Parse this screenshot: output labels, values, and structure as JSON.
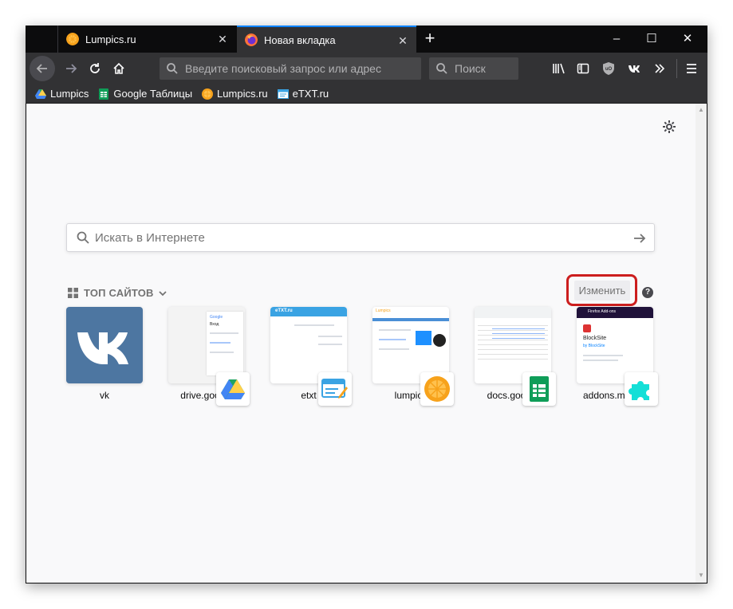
{
  "tabs": [
    {
      "title": "Lumpics.ru",
      "active": false
    },
    {
      "title": "Новая вкладка",
      "active": true
    }
  ],
  "toolbar": {
    "url_placeholder": "Введите поисковый запрос или адрес",
    "search_placeholder": "Поиск"
  },
  "bookmarks": [
    {
      "label": "Lumpics",
      "icon": "google-drive-icon"
    },
    {
      "label": "Google Таблицы",
      "icon": "google-sheets-icon"
    },
    {
      "label": "Lumpics.ru",
      "icon": "lumpics-orange-icon"
    },
    {
      "label": "eTXT.ru",
      "icon": "etxt-icon"
    }
  ],
  "newtab": {
    "search_placeholder": "Искать в Интернете",
    "topsites_title": "ТОП САЙТОВ",
    "edit_label": "Изменить",
    "help_label": "?"
  },
  "topsites": [
    {
      "label": "vk"
    },
    {
      "label": "drive.google"
    },
    {
      "label": "etxt"
    },
    {
      "label": "lumpics"
    },
    {
      "label": "docs.google"
    },
    {
      "label": "addons.mozilla"
    }
  ],
  "thumbs": {
    "google_title": "Google",
    "google_sub": "Вход",
    "etxt_logo": "eTXT.ru",
    "lumpics_head": "Lumpics",
    "addons_title": "Firefox Add-ons",
    "addons_name": "BlockSite",
    "addons_by": "by BlockSite"
  },
  "colors": {
    "accent": "#0a84ff",
    "vk_blue": "#4d76a1",
    "highlight_red": "#cc1e1e"
  }
}
